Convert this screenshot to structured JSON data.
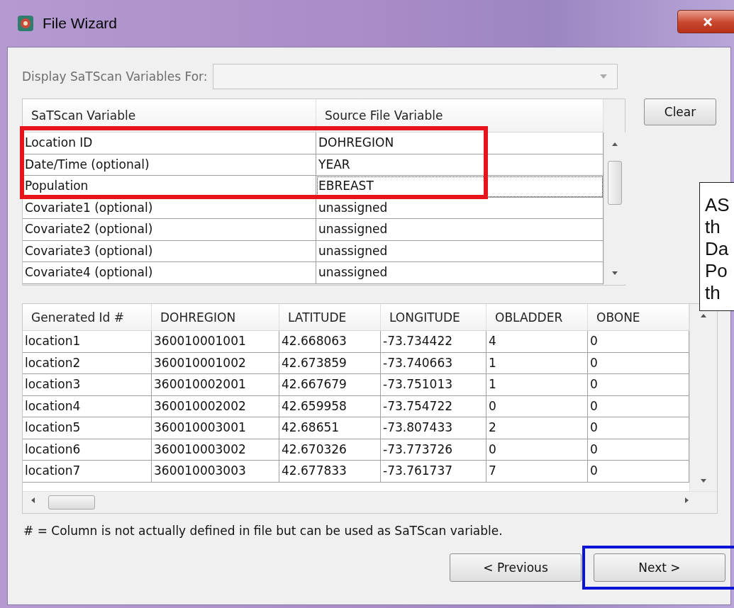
{
  "window": {
    "title": "File Wizard"
  },
  "display_for": {
    "label": "Display SaTScan Variables For:",
    "disabled": true
  },
  "variables_table": {
    "columns": [
      "SaTScan Variable",
      "Source File Variable"
    ],
    "rows": [
      {
        "variable": "Location ID",
        "source": "DOHREGION",
        "focused": false
      },
      {
        "variable": "Date/Time (optional)",
        "source": "YEAR",
        "focused": false
      },
      {
        "variable": "Population",
        "source": "EBREAST",
        "focused": true
      },
      {
        "variable": "Covariate1 (optional)",
        "source": "unassigned",
        "focused": false
      },
      {
        "variable": "Covariate2 (optional)",
        "source": "unassigned",
        "focused": false
      },
      {
        "variable": "Covariate3 (optional)",
        "source": "unassigned",
        "focused": false
      },
      {
        "variable": "Covariate4 (optional)",
        "source": "unassigned",
        "focused": false
      }
    ]
  },
  "clear_button": "Clear",
  "data_table": {
    "columns": [
      "Generated Id #",
      "DOHREGION",
      "LATITUDE",
      "LONGITUDE",
      "OBLADDER",
      "OBONE"
    ],
    "rows": [
      [
        "location1",
        "360010001001",
        "42.668063",
        "-73.734422",
        "4",
        "0"
      ],
      [
        "location2",
        "360010001002",
        "42.673859",
        "-73.740663",
        "1",
        "0"
      ],
      [
        "location3",
        "360010002001",
        "42.667679",
        "-73.751013",
        "1",
        "0"
      ],
      [
        "location4",
        "360010002002",
        "42.659958",
        "-73.754722",
        "0",
        "0"
      ],
      [
        "location5",
        "360010003001",
        "42.68651",
        "-73.807433",
        "2",
        "0"
      ],
      [
        "location6",
        "360010003002",
        "42.670326",
        "-73.773726",
        "0",
        "0"
      ],
      [
        "location7",
        "360010003003",
        "42.677833",
        "-73.761737",
        "7",
        "0"
      ]
    ]
  },
  "footnote": "# = Column is not actually defined in file but can be used as SaTScan variable.",
  "buttons": [
    {
      "label": "< Previous",
      "highlighted": false
    },
    {
      "label": "Next >",
      "highlighted": true
    }
  ],
  "callout": {
    "lines": [
      "AS",
      "th",
      "Da",
      "Po",
      "th"
    ]
  }
}
